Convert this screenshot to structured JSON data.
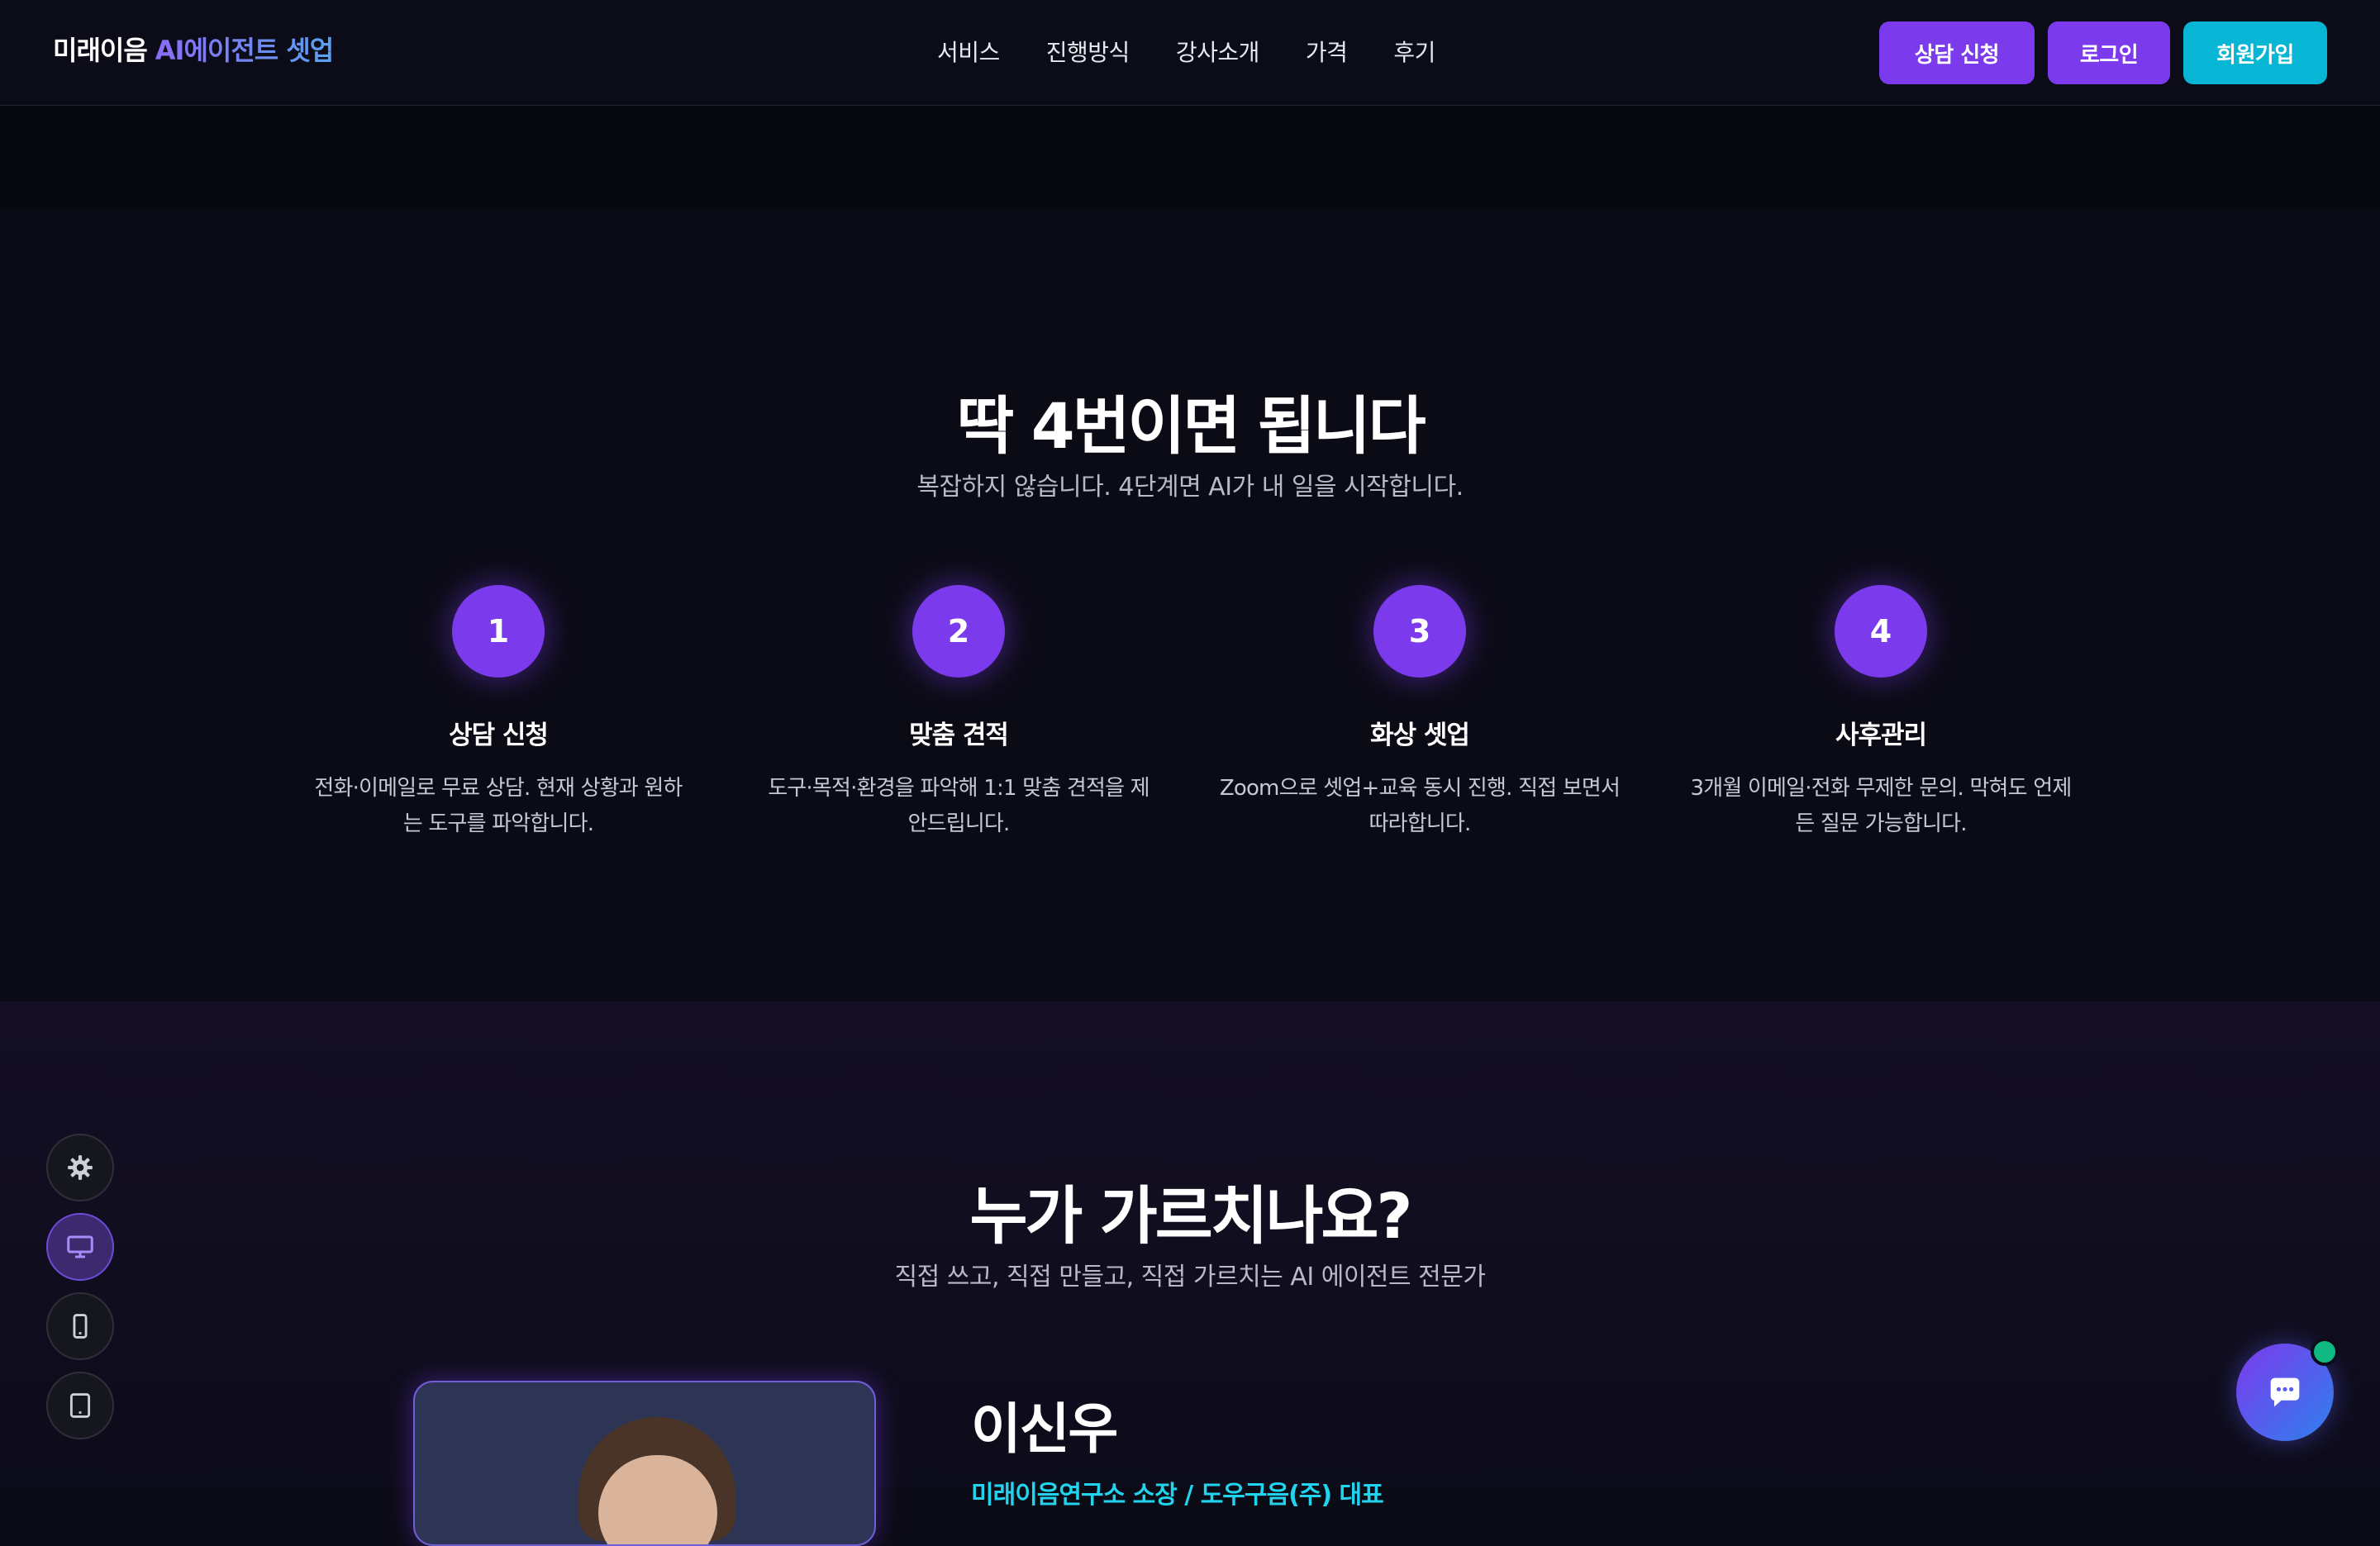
{
  "header": {
    "logo_main": "미래이음",
    "logo_accent": "AI에이전트 셋업",
    "nav": [
      "서비스",
      "진행방식",
      "강사소개",
      "가격",
      "후기"
    ],
    "buttons": {
      "consult": "상담 신청",
      "login": "로그인",
      "signup": "회원가입"
    }
  },
  "colors": {
    "accent": "#7c3aed",
    "cyan": "#06b6d4",
    "background": "#0b0b15",
    "online": "#10b981"
  },
  "steps_section": {
    "title": "딱 4번이면 됩니다",
    "subtitle": "복잡하지 않습니다. 4단계면 AI가 내 일을 시작합니다.",
    "steps": [
      {
        "number": "1",
        "title": "상담 신청",
        "desc_line1": "전화·이메일로 무료 상담. 현재 상황과 원하",
        "desc_line2": "는 도구를 파악합니다."
      },
      {
        "number": "2",
        "title": "맞춤 견적",
        "desc_line1": "도구·목적·환경을 파악해 1:1 맞춤 견적을 제",
        "desc_line2": "안드립니다."
      },
      {
        "number": "3",
        "title": "화상 셋업",
        "desc_line1": "Zoom으로 셋업+교육 동시 진행. 직접 보면서",
        "desc_line2": "따라합니다."
      },
      {
        "number": "4",
        "title": "사후관리",
        "desc_line1": "3개월 이메일·전화 무제한 문의. 막혀도 언제",
        "desc_line2": "든 질문 가능합니다."
      }
    ]
  },
  "instructor_section": {
    "title": "누가 가르치나요?",
    "subtitle": "직접 쓰고, 직접 만들고, 직접 가르치는 AI 에이전트 전문가",
    "name": "이신우",
    "role": "미래이음연구소 소장 / 도우구음(주) 대표"
  },
  "toolbar": {
    "icons": [
      "gear-icon",
      "desktop-icon",
      "mobile-icon",
      "tablet-icon"
    ],
    "active": "desktop-icon"
  },
  "chat": {
    "icon": "chat-bubble-icon",
    "status": "online"
  }
}
